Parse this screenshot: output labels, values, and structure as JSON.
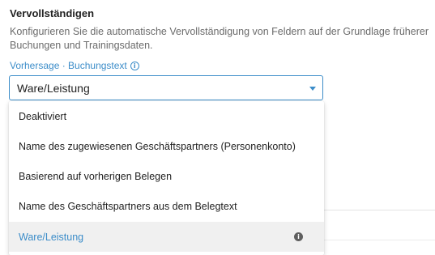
{
  "section": {
    "title": "Vervollständigen",
    "description": "Konfigurieren Sie die automatische Vervollständigung von Feldern auf der Grundlage früherer Buchungen und Trainingsdaten."
  },
  "field": {
    "label": "Vorhersage · Buchungstext",
    "label_icon": "info-icon",
    "selected_value": "Ware/Leistung"
  },
  "dropdown": {
    "options": [
      {
        "label": "Deaktiviert"
      },
      {
        "label": "Name des zugewiesenen Geschäftspartners (Personenkonto)"
      },
      {
        "label": "Basierend auf vorherigen Belegen"
      },
      {
        "label": "Name des Geschäftspartners aus dem Belegtext"
      },
      {
        "label": "Ware/Leistung",
        "selected": true,
        "icon": "info-icon"
      }
    ]
  },
  "colors": {
    "accent": "#3c8dc9",
    "description_text": "#6b6b6b",
    "selected_bg": "#f0f0f0"
  }
}
